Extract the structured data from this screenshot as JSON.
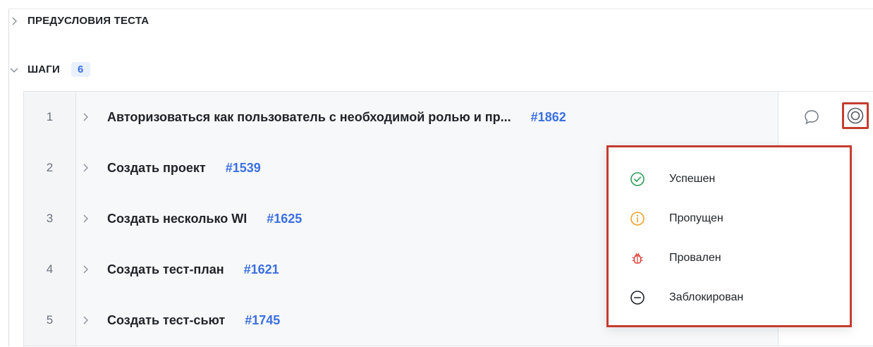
{
  "sections": {
    "preconditions": {
      "label": "ПРЕДУСЛОВИЯ ТЕСТА"
    },
    "steps": {
      "label": "ШАГИ",
      "count": "6"
    }
  },
  "steps": [
    {
      "num": "1",
      "title": "Авторизоваться как пользователь с необходимой ролью и пр...",
      "id": "#1862"
    },
    {
      "num": "2",
      "title": "Создать проект",
      "id": "#1539"
    },
    {
      "num": "3",
      "title": "Создать несколько WI",
      "id": "#1625"
    },
    {
      "num": "4",
      "title": "Создать тест-план",
      "id": "#1621"
    },
    {
      "num": "5",
      "title": "Создать тест-сьют",
      "id": "#1745"
    }
  ],
  "status_menu": [
    {
      "label": "Успешен",
      "icon": "check-circle-icon",
      "color": "#2e9e5b"
    },
    {
      "label": "Пропущен",
      "icon": "info-circle-icon",
      "color": "#f0a028"
    },
    {
      "label": "Провален",
      "icon": "bug-icon",
      "color": "#e0413a"
    },
    {
      "label": "Заблокирован",
      "icon": "minus-circle-icon",
      "color": "#1f2328"
    }
  ],
  "colors": {
    "accent": "#3b6fe0",
    "highlight_border": "#c43d2f",
    "row_bg": "#f7f8fa"
  }
}
